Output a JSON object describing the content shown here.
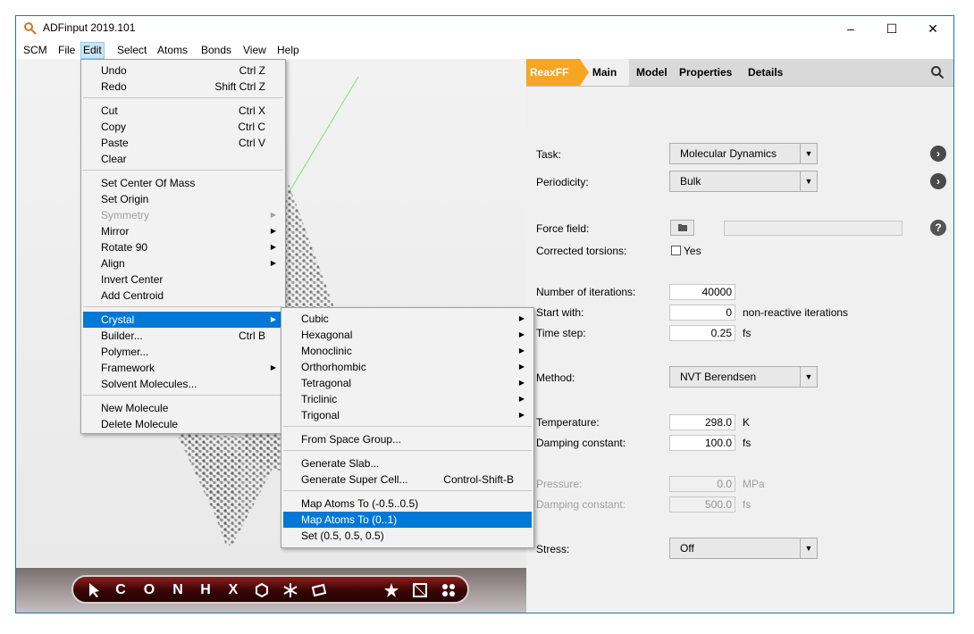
{
  "window": {
    "title": "ADFinput 2019.101"
  },
  "menubar": [
    "SCM",
    "File",
    "Edit",
    "Select",
    "Atoms",
    "Bonds",
    "View",
    "Help"
  ],
  "edit_menu": {
    "items": [
      {
        "label": "Undo",
        "shortcut": "Ctrl Z"
      },
      {
        "label": "Redo",
        "shortcut": "Shift Ctrl Z"
      },
      {
        "label": "Cut",
        "shortcut": "Ctrl X"
      },
      {
        "label": "Copy",
        "shortcut": "Ctrl C"
      },
      {
        "label": "Paste",
        "shortcut": "Ctrl V"
      },
      {
        "label": "Clear",
        "shortcut": ""
      },
      {
        "label": "Set Center Of Mass",
        "shortcut": ""
      },
      {
        "label": "Set Origin",
        "shortcut": ""
      },
      {
        "label": "Symmetry",
        "shortcut": ""
      },
      {
        "label": "Mirror",
        "shortcut": ""
      },
      {
        "label": "Rotate 90",
        "shortcut": ""
      },
      {
        "label": "Align",
        "shortcut": ""
      },
      {
        "label": "Invert Center",
        "shortcut": ""
      },
      {
        "label": "Add Centroid",
        "shortcut": ""
      },
      {
        "label": "Crystal",
        "shortcut": ""
      },
      {
        "label": "Builder...",
        "shortcut": "Ctrl B"
      },
      {
        "label": "Polymer...",
        "shortcut": ""
      },
      {
        "label": "Framework",
        "shortcut": ""
      },
      {
        "label": "Solvent Molecules...",
        "shortcut": ""
      },
      {
        "label": "New Molecule",
        "shortcut": ""
      },
      {
        "label": "Delete Molecule",
        "shortcut": ""
      }
    ]
  },
  "crystal_submenu": {
    "items": [
      {
        "label": "Cubic",
        "shortcut": ""
      },
      {
        "label": "Hexagonal",
        "shortcut": ""
      },
      {
        "label": "Monoclinic",
        "shortcut": ""
      },
      {
        "label": "Orthorhombic",
        "shortcut": ""
      },
      {
        "label": "Tetragonal",
        "shortcut": ""
      },
      {
        "label": "Triclinic",
        "shortcut": ""
      },
      {
        "label": "Trigonal",
        "shortcut": ""
      },
      {
        "label": "From Space Group...",
        "shortcut": ""
      },
      {
        "label": "Generate Slab...",
        "shortcut": ""
      },
      {
        "label": "Generate Super Cell...",
        "shortcut": "Control-Shift-B"
      },
      {
        "label": "Map Atoms To (-0.5..0.5)",
        "shortcut": ""
      },
      {
        "label": "Map Atoms To (0..1)",
        "shortcut": ""
      },
      {
        "label": "Set (0.5, 0.5, 0.5)",
        "shortcut": ""
      }
    ]
  },
  "toolbar": [
    "C",
    "O",
    "N",
    "H",
    "X"
  ],
  "tabs": {
    "engine": "ReaxFF",
    "main": "Main",
    "model": "Model",
    "properties": "Properties",
    "details": "Details"
  },
  "settings": {
    "task_label": "Task:",
    "task_value": "Molecular Dynamics",
    "periodicity_label": "Periodicity:",
    "periodicity_value": "Bulk",
    "forcefield_label": "Force field:",
    "corrected_torsions_label": "Corrected torsions:",
    "corrected_torsions_option": "Yes",
    "iterations_label": "Number of iterations:",
    "iterations_value": "40000",
    "start_with_label": "Start with:",
    "start_with_value": "0",
    "start_with_unit": "non-reactive iterations",
    "timestep_label": "Time step:",
    "timestep_value": "0.25",
    "timestep_unit": "fs",
    "method_label": "Method:",
    "method_value": "NVT Berendsen",
    "temperature_label": "Temperature:",
    "temperature_value": "298.0",
    "temperature_unit": "K",
    "damping_label": "Damping constant:",
    "damping_value": "100.0",
    "damping_unit": "fs",
    "pressure_label": "Pressure:",
    "pressure_value": "0.0",
    "pressure_unit": "MPa",
    "damping2_label": "Damping constant:",
    "damping2_value": "500.0",
    "damping2_unit": "fs",
    "stress_label": "Stress:",
    "stress_value": "Off"
  },
  "colors": {
    "accent": "#f5a623",
    "highlight": "#0078d7"
  }
}
